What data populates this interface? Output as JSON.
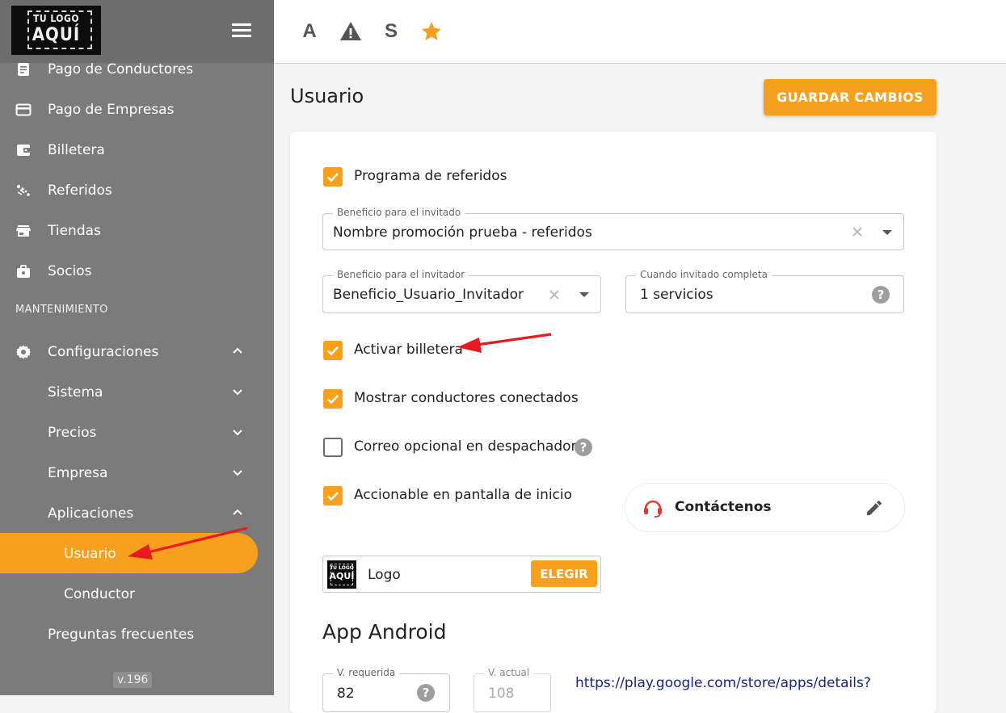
{
  "brand": {
    "logo_line1": "TU LOGO",
    "logo_line2": "AQUÍ"
  },
  "sidebar": {
    "items": [
      {
        "label": "Pago de Conductores",
        "icon": "receipt-icon"
      },
      {
        "label": "Pago de Empresas",
        "icon": "credit-card-icon"
      },
      {
        "label": "Billetera",
        "icon": "wallet-icon"
      },
      {
        "label": "Referidos",
        "icon": "referral-icon"
      },
      {
        "label": "Tiendas",
        "icon": "store-icon"
      },
      {
        "label": "Socios",
        "icon": "partners-icon"
      }
    ],
    "section_title": "MANTENIMIENTO",
    "config": {
      "label": "Configuraciones",
      "icon": "gear-icon"
    },
    "sub_items": [
      {
        "label": "Sistema"
      },
      {
        "label": "Precios"
      },
      {
        "label": "Empresa"
      },
      {
        "label": "Aplicaciones"
      }
    ],
    "app_items": [
      {
        "label": "Usuario",
        "active": true
      },
      {
        "label": "Conductor",
        "active": false
      }
    ],
    "faq": {
      "label": "Preguntas frecuentes"
    },
    "version": "v.196"
  },
  "topbar": {
    "a_label": "A",
    "s_label": "S",
    "icons": [
      "font-icon",
      "warning-icon",
      "s-icon",
      "star-icon"
    ]
  },
  "page": {
    "title": "Usuario",
    "save_label": "GUARDAR CAMBIOS"
  },
  "form": {
    "referral_program": {
      "label": "Programa de referidos",
      "checked": true
    },
    "invitee_benefit": {
      "label": "Beneficio para el invitado",
      "value": "Nombre promoción prueba - referidos"
    },
    "inviter_benefit": {
      "label": "Beneficio para el invitador",
      "value": "Beneficio_Usuario_Invitador"
    },
    "invitee_completes": {
      "label": "Cuando invitado completa",
      "value": "1 servicios"
    },
    "activate_wallet": {
      "label": "Activar billetera",
      "checked": true
    },
    "show_drivers": {
      "label": "Mostrar conductores conectados",
      "checked": true
    },
    "optional_email": {
      "label": "Correo opcional en despachador",
      "checked": false
    },
    "home_action": {
      "label": "Accionable en pantalla de inicio",
      "checked": true
    },
    "contact_card": {
      "label": "Contáctenos",
      "icon": "headset-icon"
    },
    "logo_field": {
      "label": "Logo",
      "button_label": "ELEGIR",
      "preview_line1": "TU LOGO",
      "preview_line2": "AQUÍ"
    },
    "android": {
      "title": "App Android",
      "required_version": {
        "label": "V. requerida",
        "value": "82"
      },
      "current_version": {
        "label": "V. actual",
        "value": "108"
      },
      "store_link": "https://play.google.com/store/apps/details?"
    }
  },
  "colors": {
    "accent": "#f7a01e",
    "sidebar": "#7b7b7b",
    "annotation_arrow": "#e8191f"
  }
}
